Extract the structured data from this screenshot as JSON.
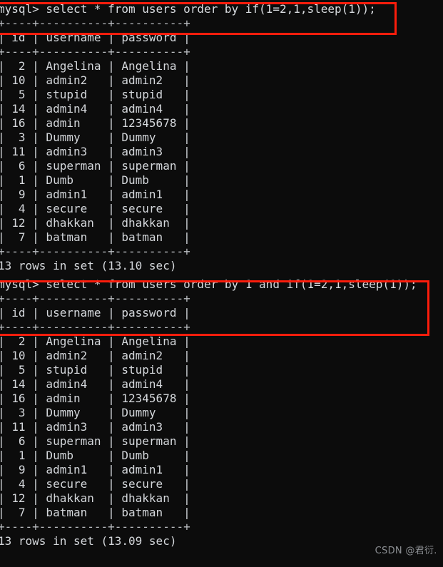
{
  "terminal": {
    "blocks": [
      {
        "prompt": "mysql> select * from users order by if(1=2,1,sleep(1));",
        "top_rule": "+----+----------+----------+",
        "header": "| id | username | password |",
        "mid_rule": "+----+----------+----------+",
        "rows": [
          "|  2 | Angelina | Angelina |",
          "| 10 | admin2   | admin2   |",
          "|  5 | stupid   | stupid   |",
          "| 14 | admin4   | admin4   |",
          "| 16 | admin    | 12345678 |",
          "|  3 | Dummy    | Dummy    |",
          "| 11 | admin3   | admin3   |",
          "|  6 | superman | superman |",
          "|  1 | Dumb     | Dumb     |",
          "|  9 | admin1   | admin1   |",
          "|  4 | secure   | secure   |",
          "| 12 | dhakkan  | dhakkan  |",
          "|  7 | batman   | batman   |"
        ],
        "bottom_rule": "+----+----------+----------+",
        "status": "13 rows in set (13.10 sec)"
      },
      {
        "prompt": "mysql> select * from users order by 1 and if(1=2,1,sleep(1));",
        "top_rule": "+----+----------+----------+",
        "header": "| id | username | password |",
        "mid_rule": "+----+----------+----------+",
        "rows": [
          "|  2 | Angelina | Angelina |",
          "| 10 | admin2   | admin2   |",
          "|  5 | stupid   | stupid   |",
          "| 14 | admin4   | admin4   |",
          "| 16 | admin    | 12345678 |",
          "|  3 | Dummy    | Dummy    |",
          "| 11 | admin3   | admin3   |",
          "|  6 | superman | superman |",
          "|  1 | Dumb     | Dumb     |",
          "|  9 | admin1   | admin1   |",
          "|  4 | secure   | secure   |",
          "| 12 | dhakkan  | dhakkan  |",
          "|  7 | batman   | batman   |"
        ],
        "bottom_rule": "+----+----------+----------+",
        "status": "13 rows in set (13.09 sec)"
      }
    ],
    "table_columns": [
      "id",
      "username",
      "password"
    ],
    "table_data": [
      {
        "id": "2",
        "username": "Angelina",
        "password": "Angelina"
      },
      {
        "id": "10",
        "username": "admin2",
        "password": "admin2"
      },
      {
        "id": "5",
        "username": "stupid",
        "password": "stupid"
      },
      {
        "id": "14",
        "username": "admin4",
        "password": "admin4"
      },
      {
        "id": "16",
        "username": "admin",
        "password": "12345678"
      },
      {
        "id": "3",
        "username": "Dummy",
        "password": "Dummy"
      },
      {
        "id": "11",
        "username": "admin3",
        "password": "admin3"
      },
      {
        "id": "6",
        "username": "superman",
        "password": "superman"
      },
      {
        "id": "1",
        "username": "Dumb",
        "password": "Dumb"
      },
      {
        "id": "9",
        "username": "admin1",
        "password": "admin1"
      },
      {
        "id": "4",
        "username": "secure",
        "password": "secure"
      },
      {
        "id": "12",
        "username": "dhakkan",
        "password": "dhakkan"
      },
      {
        "id": "7",
        "username": "batman",
        "password": "batman"
      }
    ],
    "annotation_color": "#fc1d0c",
    "background_color": "#0c0c0c",
    "text_color": "#d4d7db"
  },
  "watermark": {
    "text": "CSDN @君衍.\u0001"
  }
}
